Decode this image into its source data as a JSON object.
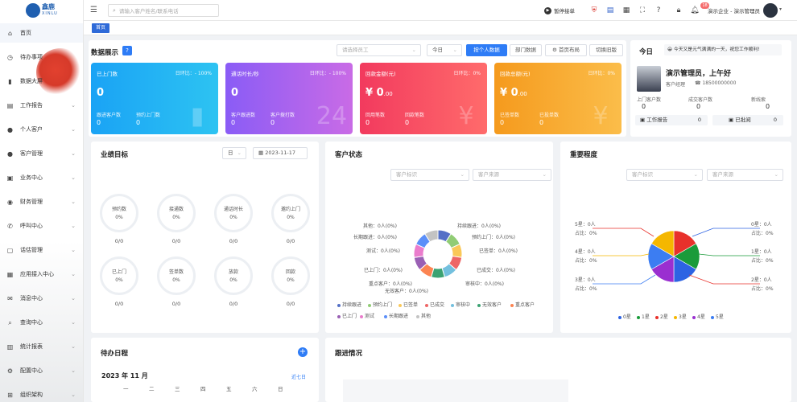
{
  "brand": {
    "name": "鑫鹿",
    "sub": "XINLU"
  },
  "sidebar": {
    "items": [
      {
        "label": "首页",
        "icon": "home-icon",
        "active": true,
        "chevron": false
      },
      {
        "label": "待办事项",
        "icon": "clock-icon",
        "chevron": false
      },
      {
        "label": "数据大屏",
        "icon": "bar-chart-icon",
        "chevron": false
      },
      {
        "label": "工作报告",
        "icon": "report-icon",
        "chevron": true
      },
      {
        "label": "个人客户",
        "icon": "person-icon",
        "chevron": true
      },
      {
        "label": "客户管理",
        "icon": "users-icon",
        "chevron": true
      },
      {
        "label": "业务中心",
        "icon": "briefcase-icon",
        "chevron": true
      },
      {
        "label": "财务管理",
        "icon": "finance-icon",
        "chevron": true
      },
      {
        "label": "呼叫中心",
        "icon": "phone-icon",
        "chevron": true
      },
      {
        "label": "话估管理",
        "icon": "chat-icon",
        "chevron": true
      },
      {
        "label": "应用接入中心",
        "icon": "app-icon",
        "chevron": true
      },
      {
        "label": "消息中心",
        "icon": "message-icon",
        "chevron": true
      },
      {
        "label": "查询中心",
        "icon": "search-icon",
        "chevron": true
      },
      {
        "label": "统计报表",
        "icon": "stats-icon",
        "chevron": true
      },
      {
        "label": "配置中心",
        "icon": "settings-icon",
        "chevron": true
      },
      {
        "label": "组织架构",
        "icon": "org-icon",
        "chevron": true
      }
    ]
  },
  "header": {
    "search_placeholder": "请输入客户姓名/联系电话",
    "pause_label": "暂停接单",
    "notif_count": "18",
    "company_user": "演示企业 - 演示管理员"
  },
  "tabbar": {
    "tab": "首页"
  },
  "data_panel": {
    "title": "数据展示",
    "employee_placeholder": "请选择员工",
    "period": "今日",
    "btn_personal": "按个人数据",
    "btn_dept": "部门数据",
    "btn_layout": "首页布局",
    "btn_switch": "切换旧版"
  },
  "cards": [
    {
      "title": "已上门数",
      "ratio": "日环比：- 100%",
      "value": "0",
      "l1": "跟进客户数",
      "v1": "0",
      "l2": "预约上门数",
      "v2": "0",
      "color1": "#1aa3f5",
      "color2": "#2dc3f2"
    },
    {
      "title": "通话时长/秒",
      "ratio": "日环比：- 100%",
      "value": "0",
      "l1": "客户跟进数",
      "v1": "0",
      "l2": "客户拨打数",
      "v2": "0",
      "color1": "#8a5cf6",
      "color2": "#c96be6"
    },
    {
      "title": "回款金额(元)",
      "ratio": "日环比：0%",
      "value": "¥ 0",
      "value_sub": ".00",
      "l1": "回用笔数",
      "v1": "0",
      "l2": "回款笔数",
      "v2": "0",
      "color1": "#f23a5e",
      "color2": "#ff6b6b"
    },
    {
      "title": "回款总额(元)",
      "ratio": "日环比：0%",
      "value": "¥ 0",
      "value_sub": ".00",
      "l1": "已签单数",
      "v1": "0",
      "l2": "已投单数",
      "v2": "0",
      "color1": "#f59a1d",
      "color2": "#fbbd4a"
    }
  ],
  "today": {
    "title": "今日",
    "notice": "今天又是元气满满的一天，祝您工作顺利!",
    "greeting": "演示管理员，上午好",
    "role": "客户经理",
    "phone": "18500000000",
    "stats": [
      {
        "label": "上门客户数",
        "value": "0"
      },
      {
        "label": "成交客户数",
        "value": "0"
      },
      {
        "label": "新线索",
        "value": "0"
      }
    ],
    "report_label": "工作报告",
    "report_value": "0",
    "read_label": "已批阅",
    "read_value": "0"
  },
  "perf": {
    "title": "业绩目标",
    "period": "日",
    "date": "2023-11-17",
    "gauges": [
      {
        "label": "预约数",
        "pct": "0%",
        "under": "0/0"
      },
      {
        "label": "接通数",
        "pct": "0%",
        "under": "0/0"
      },
      {
        "label": "通话时长",
        "pct": "0%",
        "under": "0/0"
      },
      {
        "label": "邀约上门",
        "pct": "0%",
        "under": "0/0"
      },
      {
        "label": "已上门",
        "pct": "0%",
        "under": "0/0"
      },
      {
        "label": "签单数",
        "pct": "0%",
        "under": "0/0"
      },
      {
        "label": "放款",
        "pct": "0%",
        "under": "0/0"
      },
      {
        "label": "回款",
        "pct": "0%",
        "under": "0/0"
      }
    ]
  },
  "cust_status": {
    "title": "客户状态",
    "sel1": "客户标识",
    "sel2": "客户来源",
    "labels_left": [
      "其他：0人(0%)",
      "长期跟进：0人(0%)",
      "测试：0人(0%)",
      "已上门：0人(0%)",
      "重点客户：0人(0%)",
      "无效客户：0人(0%)"
    ],
    "labels_right": [
      "持续跟进：0人(0%)",
      "预约上门：0人(0%)",
      "已签单：0人(0%)",
      "已成交：0人(0%)",
      "审核中：0人(0%)"
    ],
    "legend": [
      "持续跟进",
      "预约上门",
      "已签单",
      "已成交",
      "审核中",
      "无效客户",
      "重点客户",
      "已上门",
      "测试",
      "长期跟进",
      "其他"
    ],
    "colors": [
      "#5470c6",
      "#91cc75",
      "#fac858",
      "#ee6666",
      "#73c0de",
      "#3ba272",
      "#fc8452",
      "#9a60b4",
      "#ea7ccc",
      "#5b8ff9",
      "#c3c3c3"
    ]
  },
  "importance": {
    "title": "重要程度",
    "sel1": "客户标识",
    "sel2": "客户来源",
    "labels": [
      {
        "star": "5星：0人",
        "pct": "占比：0%"
      },
      {
        "star": "4星：0人",
        "pct": "占比：0%"
      },
      {
        "star": "3星：0人",
        "pct": "占比：0%"
      },
      {
        "star": "0星：0人",
        "pct": "占比：0%"
      },
      {
        "star": "1星：0人",
        "pct": "占比：0%"
      },
      {
        "star": "2星：0人",
        "pct": "占比：0%"
      }
    ],
    "legend": [
      "0星",
      "1星",
      "2星",
      "3星",
      "4星",
      "5星"
    ],
    "colors": [
      "#2d63e3",
      "#1a9b3a",
      "#e8312b",
      "#f5b700",
      "#9a2fd0",
      "#3c7df2"
    ]
  },
  "todo": {
    "title": "待办日程",
    "month": "2023 年 11 月",
    "recent": "近七日",
    "weekdays": [
      "一",
      "二",
      "三",
      "四",
      "五",
      "六",
      "日"
    ]
  },
  "follow": {
    "title": "跟进情况"
  }
}
